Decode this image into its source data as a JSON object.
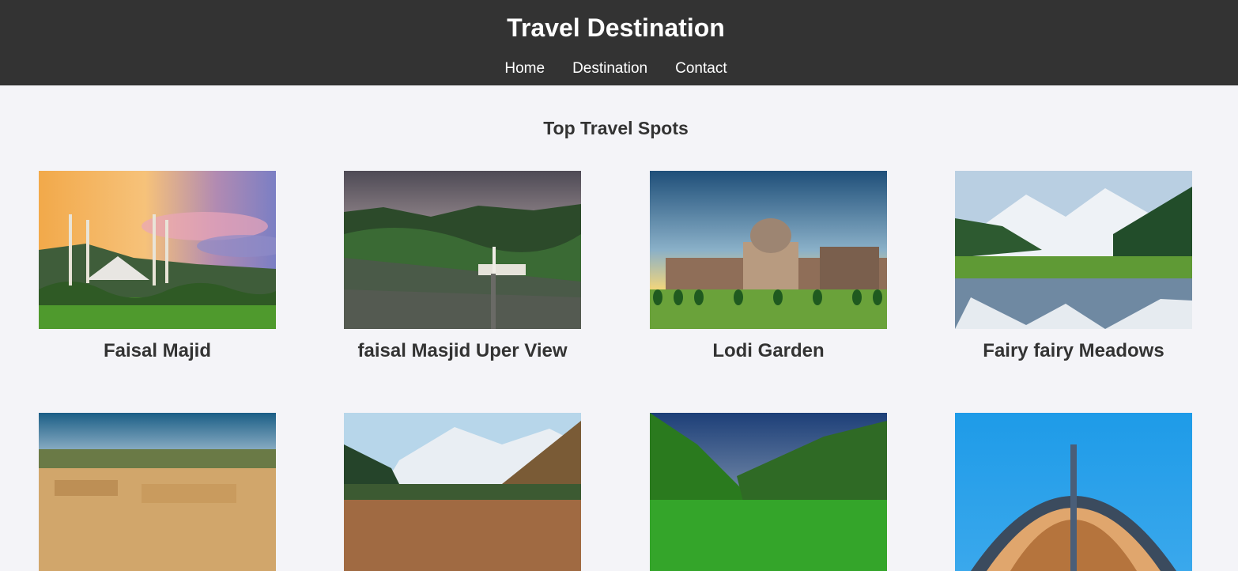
{
  "header": {
    "title": "Travel Destination",
    "nav": [
      "Home",
      "Destination",
      "Contact"
    ]
  },
  "main": {
    "section_title": "Top Travel Spots",
    "cards": [
      {
        "title": "Faisal Majid",
        "image": "faisal-mosque-sunset"
      },
      {
        "title": "faisal Masjid Uper View",
        "image": "faisal-mosque-aerial"
      },
      {
        "title": "Lodi Garden",
        "image": "lodi-garden-tomb"
      },
      {
        "title": "Fairy fairy Meadows",
        "image": "fairy-meadows-lake"
      },
      {
        "title": "",
        "image": "ancient-ruins"
      },
      {
        "title": "",
        "image": "mountain-forest"
      },
      {
        "title": "",
        "image": "green-valley"
      },
      {
        "title": "",
        "image": "monument-dome"
      }
    ]
  }
}
